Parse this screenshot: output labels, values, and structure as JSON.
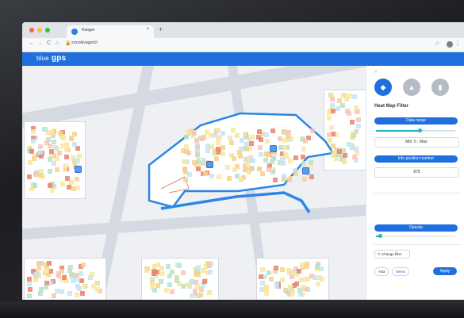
{
  "browser": {
    "tab_title": "Ranger",
    "tab_close": "×",
    "new_tab": "+",
    "url": "xxxxxbvaged.it",
    "nav": {
      "back": "←",
      "forward": "→",
      "reload": "C",
      "home": "⌂"
    },
    "window_dots": [
      "#ff5f57",
      "#febc2e",
      "#28c840"
    ]
  },
  "app": {
    "logo_part1": "blue",
    "logo_part2": "gps"
  },
  "panel": {
    "collapse_label": "»",
    "layer_buttons": [
      {
        "icon": "heatmap-layers-icon",
        "glyph": "◆",
        "color": "#1f6fde"
      },
      {
        "icon": "zones-icon",
        "glyph": "▲",
        "color": "#b5bcc6"
      },
      {
        "icon": "analytics-icon",
        "glyph": "▮",
        "color": "#b5bcc6"
      }
    ],
    "title": "Heat Map Filter",
    "data_range_label": "Data range",
    "data_range_value": "Min: 0 , Max:",
    "data_range_fill": 0.55,
    "info_label": "Info position number",
    "info_value": "875",
    "opacity_label": "Opacity",
    "opacity_fill": 0.05,
    "change_filter": "✎ Change filter",
    "add_label": "Add",
    "select_label": "Select",
    "apply_label": "Apply"
  },
  "colors": {
    "accent": "#1f6fde",
    "heat_low": "#c6e5f5",
    "heat_mid": "#f3e79b",
    "heat_high": "#e9826e"
  }
}
